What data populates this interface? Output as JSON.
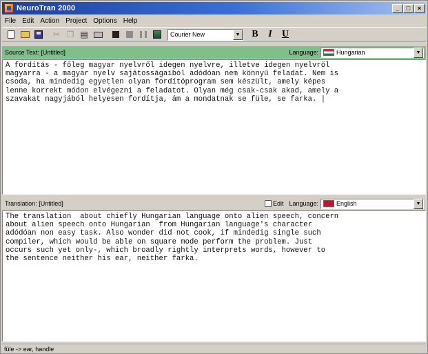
{
  "window": {
    "title": "NeuroTran 2000"
  },
  "menu": {
    "items": [
      {
        "label": "File",
        "underline": "F"
      },
      {
        "label": "Edit",
        "underline": "E"
      },
      {
        "label": "Action",
        "underline": "A"
      },
      {
        "label": "Project",
        "underline": "P"
      },
      {
        "label": "Options",
        "underline": "O"
      },
      {
        "label": "Help",
        "underline": "H"
      }
    ]
  },
  "toolbar": {
    "font": "Courier New",
    "bold_label": "B",
    "italic_label": "I",
    "underline_label": "U"
  },
  "source": {
    "title": "Source Text: [Untitled]",
    "language_label": "Language:",
    "language": "Hungarian",
    "text": "A fordítás - főleg magyar nyelvről idegen nyelvre, illetve idegen nyelvről\nmagyarra - a magyar nyelv sajátosságaiból adódóan nem könnyű feladat. Nem is\ncsoda, ha mindedig egyetlen olyan fordítóprogram sem készült, amely képes\nlenne korrekt módon elvégezni a feladatot. Olyan még csak-csak akad, amely a\nszavakat nagyjából helyesen fordítja, ám a mondatnak se füle, se farka. |"
  },
  "translation": {
    "title": "Translation: [Untitled]",
    "edit_label": "Edit",
    "language_label": "Language:",
    "language": "English",
    "text": "The translation  about chiefly Hungarian language onto alien speech, concern\nabout alien speech onto Hungarian  from Hungarian language's character\nadódóan non easy task. Also wonder did not cook, if mindedig single such\ncompiler, which would be able on square mode perform the problem. Just\noccurs such yet only-, which broadly rightly interprets words, however to\nthe sentence neither his ear, neither farka."
  },
  "status": {
    "text": "füle -> ear, handle"
  },
  "colors": {
    "source_header": "#7fbf8a",
    "titlebar": "#1c3f9e"
  }
}
